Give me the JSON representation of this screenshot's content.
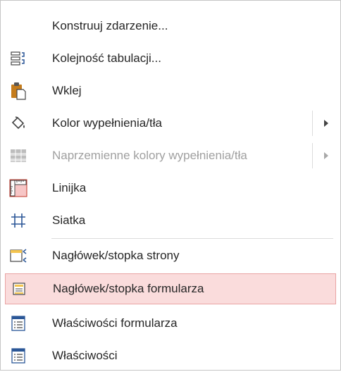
{
  "menu": {
    "items": [
      {
        "label": "Konstruuj zdarzenie...",
        "icon": "none"
      },
      {
        "label": "Kolejność tabulacji...",
        "icon": "tab-order-icon"
      },
      {
        "label": "Wklej",
        "icon": "paste-icon"
      },
      {
        "label": "Kolor wypełnienia/tła",
        "icon": "fill-color-icon",
        "submenu": true
      },
      {
        "label": "Naprzemienne kolory wypełnienia/tła",
        "icon": "alternate-fill-icon",
        "submenu": true,
        "disabled": true
      },
      {
        "label": "Linijka",
        "icon": "ruler-icon"
      },
      {
        "label": "Siatka",
        "icon": "grid-icon"
      },
      {
        "label": "Nagłówek/stopka strony",
        "icon": "page-header-footer-icon"
      },
      {
        "label": "Nagłówek/stopka formularza",
        "icon": "form-header-footer-icon",
        "highlighted": true
      },
      {
        "label": "Właściwości formularza",
        "icon": "form-properties-icon"
      },
      {
        "label": "Właściwości",
        "icon": "properties-icon"
      }
    ]
  },
  "colors": {
    "highlight_bg": "#fadcdc",
    "highlight_border": "#e9a3a3",
    "text": "#262626",
    "disabled_text": "#a0a0a0",
    "icon_blue": "#2b5797"
  }
}
